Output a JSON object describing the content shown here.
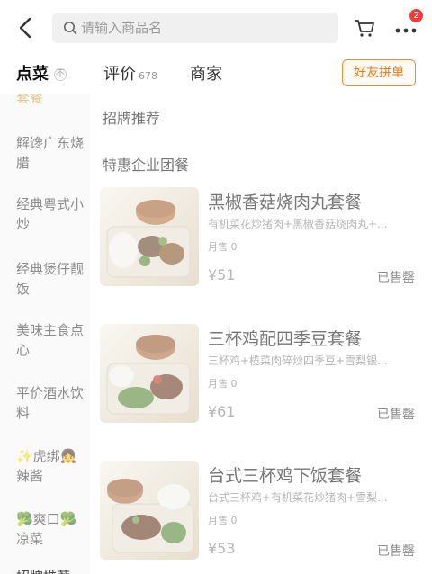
{
  "header": {
    "search_placeholder": "请输入商品名",
    "cart_badge": "2"
  },
  "tabs": {
    "menu": "点菜",
    "menu_sub": "不",
    "reviews": "评价",
    "reviews_count": "678",
    "shop": "商家",
    "friend_group": "好友拼单"
  },
  "sidebar": {
    "items": [
      {
        "label": "套餐"
      },
      {
        "label": "解馋广东烧腊"
      },
      {
        "label": "经典粤式小炒"
      },
      {
        "label": "经典煲仔靓饭"
      },
      {
        "label": "美味主食点心"
      },
      {
        "label": "平价酒水饮料"
      },
      {
        "label": "✨虎绑👧辣酱"
      },
      {
        "label": "🥦爽口🥦凉菜"
      }
    ]
  },
  "main": {
    "sections": [
      {
        "title": "招牌推荐"
      },
      {
        "title": "特惠企业团餐"
      }
    ],
    "items": [
      {
        "name": "黑椒香菇烧肉丸套餐",
        "desc": "有机菜花炒猪肉+黑椒香菇烧肉丸+...",
        "sold": "月售 0",
        "price": "¥51",
        "status": "已售罄"
      },
      {
        "name": "三杯鸡配四季豆套餐",
        "desc": "三杯鸡+榄菜肉碎炒四季豆+雪梨银...",
        "sold": "月售 0",
        "price": "¥61",
        "status": "已售罄"
      },
      {
        "name": "台式三杯鸡下饭套餐",
        "desc": "台式三杯鸡+有机菜花炒猪肉+雪梨...",
        "sold": "月售 0",
        "price": "¥53",
        "status": "已售罄"
      }
    ],
    "next_section_peek": "招牌推荐"
  }
}
